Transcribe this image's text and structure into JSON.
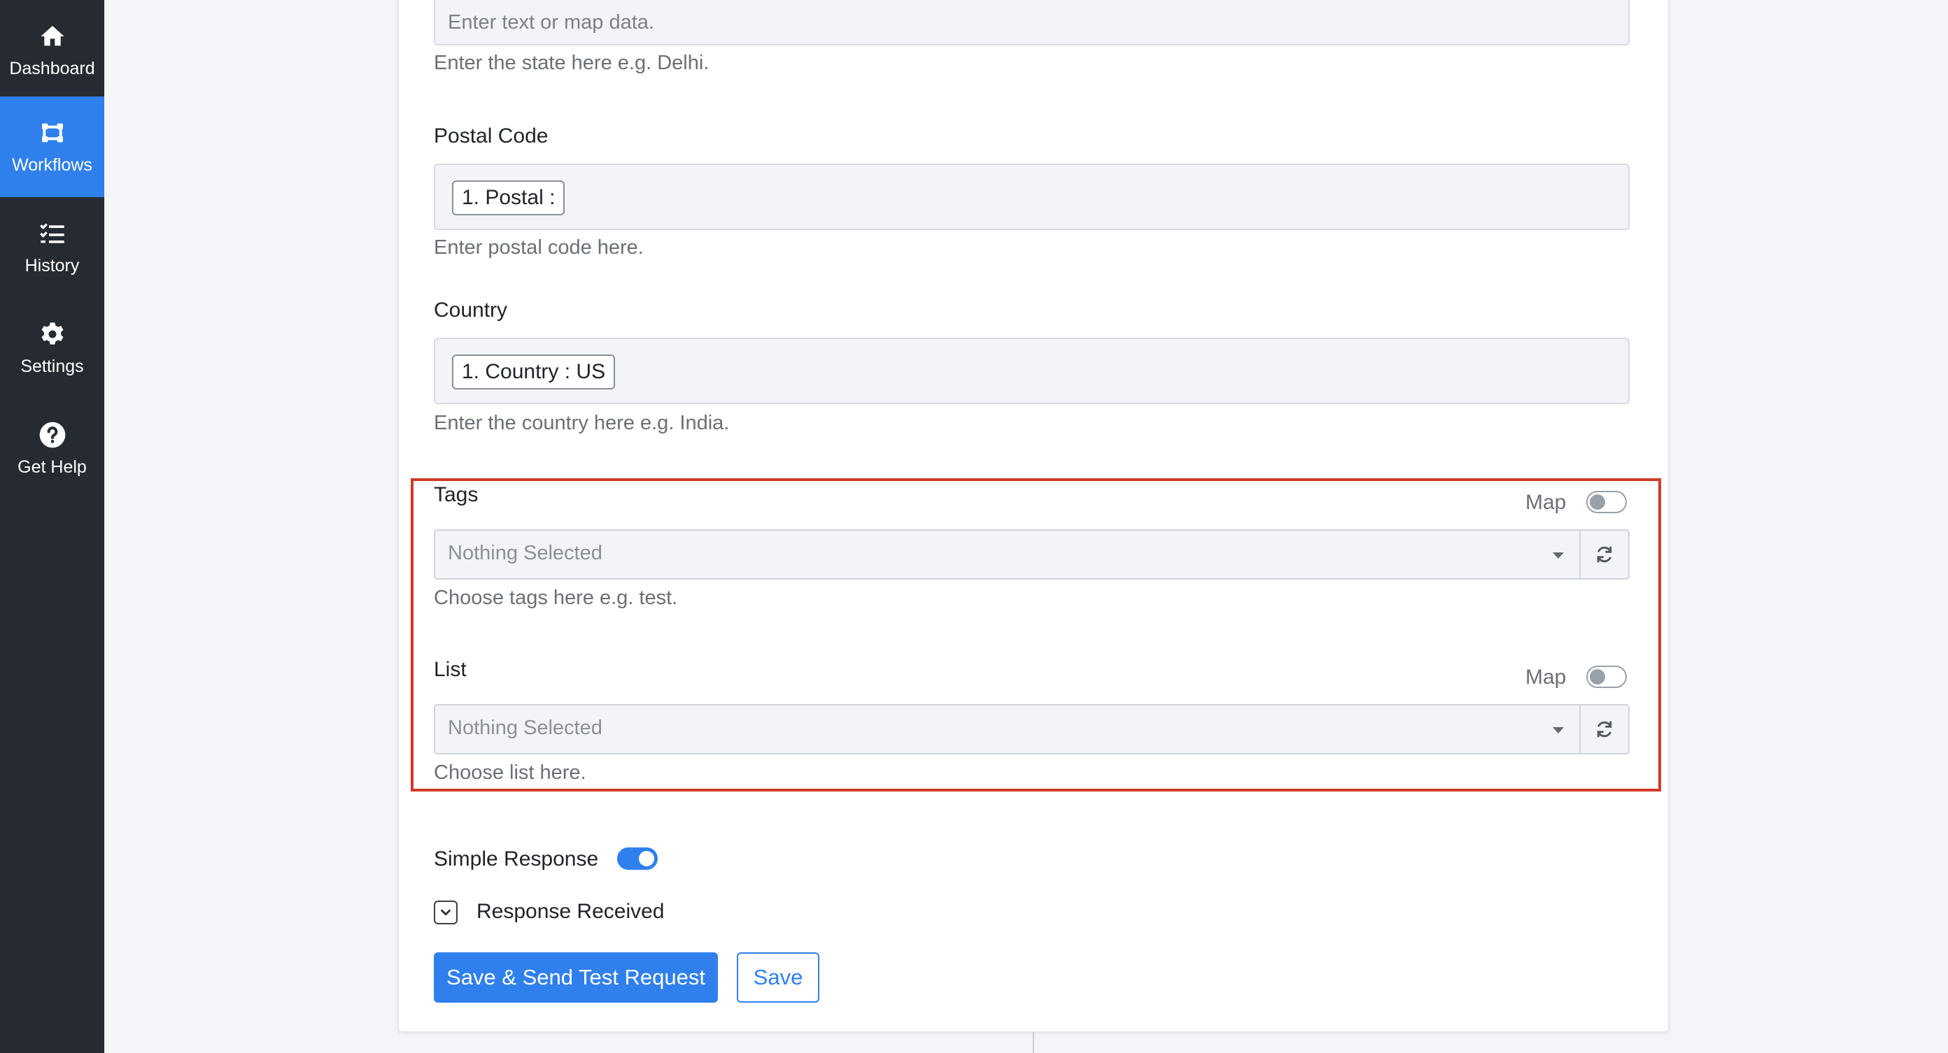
{
  "sidebar": {
    "items": [
      {
        "label": "Dashboard",
        "icon": "home-icon"
      },
      {
        "label": "Workflows",
        "icon": "workflow-icon",
        "active": true
      },
      {
        "label": "History",
        "icon": "list-check-icon"
      },
      {
        "label": "Settings",
        "icon": "gear-icon"
      },
      {
        "label": "Get Help",
        "icon": "question-circle-icon"
      }
    ]
  },
  "form": {
    "state": {
      "placeholder": "Enter text or map data.",
      "help": "Enter the state here e.g. Delhi."
    },
    "postal_code": {
      "label": "Postal Code",
      "chip": "1. Postal :",
      "help": "Enter postal code here."
    },
    "country": {
      "label": "Country",
      "chip": "1. Country : US",
      "help": "Enter the country here e.g. India."
    },
    "tags": {
      "label": "Tags",
      "map_label": "Map",
      "map_toggle": "off",
      "select_value": "Nothing Selected",
      "help": "Choose tags here e.g. test."
    },
    "list": {
      "label": "List",
      "map_label": "Map",
      "map_toggle": "off",
      "select_value": "Nothing Selected",
      "help": "Choose list here."
    },
    "simple_response": {
      "label": "Simple Response",
      "toggle": "on"
    },
    "response_received": {
      "label": "Response Received"
    },
    "buttons": {
      "save_send": "Save & Send Test Request",
      "save": "Save"
    }
  },
  "colors": {
    "sidebar_bg": "#262a31",
    "accent": "#2f80ed",
    "highlight_border": "#d33a2a"
  }
}
